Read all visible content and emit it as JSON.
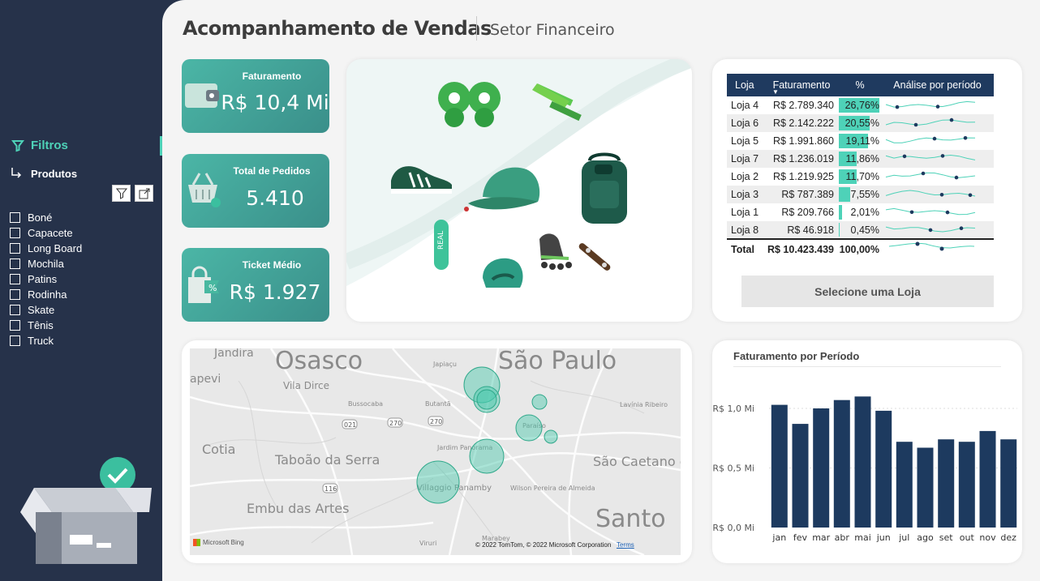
{
  "sidebar": {
    "filters_label": "Filtros",
    "products_label": "Produtos",
    "products": [
      "Boné",
      "Capacete",
      "Long Board",
      "Mochila",
      "Patins",
      "Rodinha",
      "Skate",
      "Tênis",
      "Truck"
    ]
  },
  "header": {
    "title": "Acompanhamento de Vendas",
    "subtitle": "Setor Financeiro"
  },
  "kpis": {
    "revenue": {
      "label": "Faturamento",
      "value": "R$ 10,4 Mi"
    },
    "orders": {
      "label": "Total de Pedidos",
      "value": "5.410"
    },
    "ticket": {
      "label": "Ticket Médio",
      "value": "R$ 1.927"
    }
  },
  "store_table": {
    "headers": [
      "Loja",
      "Faturamento",
      "%",
      "Análise por período"
    ],
    "rows": [
      {
        "loja": "Loja 4",
        "fat": "R$ 2.789.340",
        "pct": "26,76%",
        "share": 26.76
      },
      {
        "loja": "Loja 6",
        "fat": "R$ 2.142.222",
        "pct": "20,55%",
        "share": 20.55
      },
      {
        "loja": "Loja 5",
        "fat": "R$ 1.991.860",
        "pct": "19,11%",
        "share": 19.11
      },
      {
        "loja": "Loja 7",
        "fat": "R$ 1.236.019",
        "pct": "11,86%",
        "share": 11.86
      },
      {
        "loja": "Loja 2",
        "fat": "R$ 1.219.925",
        "pct": "11,70%",
        "share": 11.7
      },
      {
        "loja": "Loja 3",
        "fat": "R$ 787.389",
        "pct": "7,55%",
        "share": 7.55
      },
      {
        "loja": "Loja 1",
        "fat": "R$ 209.766",
        "pct": "2,01%",
        "share": 2.01
      },
      {
        "loja": "Loja 8",
        "fat": "R$ 46.918",
        "pct": "0,45%",
        "share": 0.45
      }
    ],
    "total": {
      "loja": "Total",
      "fat": "R$ 10.423.439",
      "pct": "100,00%"
    },
    "button_label": "Selecione uma Loja"
  },
  "map": {
    "places": [
      "Jandira",
      "Osasco",
      "São Paulo",
      "apevi",
      "Vila Dirce",
      "Japiaçu",
      "Bussocaba",
      "Butantã",
      "Lavínia Ribeiro",
      "Paraíso",
      "Jardim Panorama",
      "Cotia",
      "Taboão da Serra",
      "São Caetano do Sul",
      "Villaggio Panamby",
      "Wilson Pereira de Almeida",
      "Embu das Artes",
      "Santo",
      "Viruri",
      "Marabey"
    ],
    "roads": [
      "021",
      "270",
      "270",
      "116"
    ],
    "attribution": "© 2022 TomTom, © 2022 Microsoft Corporation",
    "terms": "Terms",
    "provider": "Microsoft Bing"
  },
  "chart_data": {
    "type": "bar",
    "title": "Faturamento por Período",
    "categories": [
      "jan",
      "fev",
      "mar",
      "abr",
      "mai",
      "jun",
      "jul",
      "ago",
      "set",
      "out",
      "nov",
      "dez"
    ],
    "values": [
      1.03,
      0.87,
      1.0,
      1.07,
      1.1,
      0.98,
      0.72,
      0.67,
      0.74,
      0.72,
      0.81,
      0.74
    ],
    "y_ticks": [
      "R$ 0,0 Mi",
      "R$ 0,5 Mi",
      "R$ 1,0 Mi"
    ],
    "ylim": [
      0,
      1.0
    ],
    "color": "#1d3a5f",
    "grid": true
  },
  "colors": {
    "accent": "#4ed2b8",
    "navy": "#26324a",
    "bar": "#1d3a5f",
    "teal": "#3fa59a"
  }
}
